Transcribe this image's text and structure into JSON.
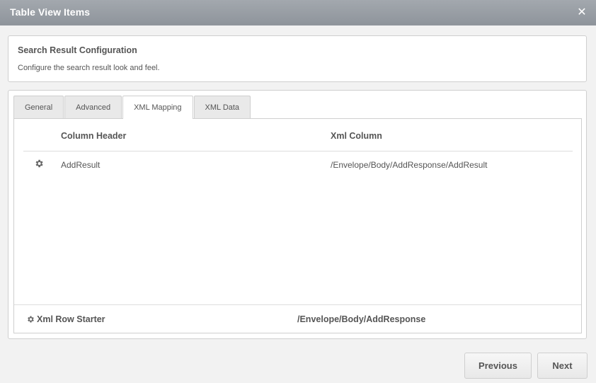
{
  "dialog": {
    "title": "Table View Items",
    "close_icon": "close-icon"
  },
  "info": {
    "heading": "Search Result Configuration",
    "description": "Configure the search result look and feel."
  },
  "tabs": [
    {
      "label": "General",
      "active": false
    },
    {
      "label": "Advanced",
      "active": false
    },
    {
      "label": "XML Mapping",
      "active": true
    },
    {
      "label": "XML Data",
      "active": false
    }
  ],
  "mapping": {
    "columns": {
      "header": "Column Header",
      "xml": "Xml Column"
    },
    "rows": [
      {
        "icon": "gear-icon",
        "header": "AddResult",
        "xml": "/Envelope/Body/AddResponse/AddResult"
      }
    ]
  },
  "row_starter": {
    "icon": "gear-icon",
    "label": "Xml Row Starter",
    "value": "/Envelope/Body/AddResponse"
  },
  "buttons": {
    "previous": "Previous",
    "next": "Next"
  },
  "colors": {
    "titlebar": "#969ba2",
    "text": "#555555",
    "border": "#cfcfcf"
  }
}
